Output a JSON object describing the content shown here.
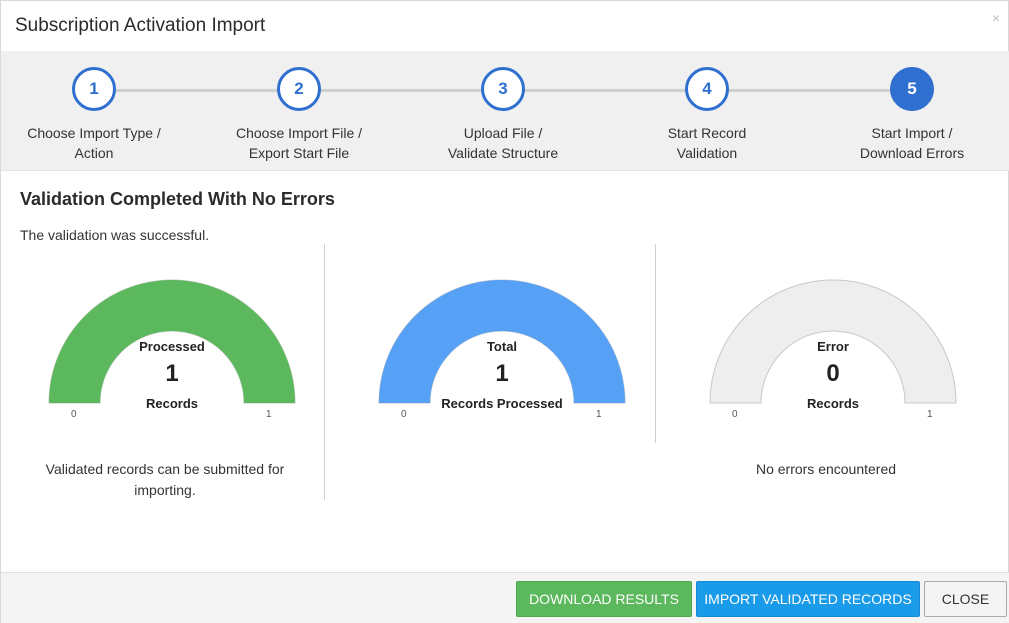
{
  "dialog": {
    "title": "Subscription Activation Import",
    "close_glyph": "×"
  },
  "steps": [
    {
      "number": "1",
      "line1": "Choose Import Type /",
      "line2": "Action"
    },
    {
      "number": "2",
      "line1": "Choose Import File /",
      "line2": "Export Start File"
    },
    {
      "number": "3",
      "line1": "Upload File /",
      "line2": "Validate Structure"
    },
    {
      "number": "4",
      "line1": "Start Record",
      "line2": "Validation"
    },
    {
      "number": "5",
      "line1": "Start Import /",
      "line2": "Download Errors"
    }
  ],
  "active_step": 5,
  "content": {
    "heading": "Validation Completed With No Errors",
    "subtext": "The validation was successful."
  },
  "gauges": [
    {
      "title": "Processed",
      "value": "1",
      "caption": "Records",
      "min": "0",
      "max": "1",
      "fraction": 1,
      "color": "#5cb85c",
      "description_line1": "Validated records can be submitted for",
      "description_line2": "importing."
    },
    {
      "title": "Total",
      "value": "1",
      "caption": "Records Processed",
      "min": "0",
      "max": "1",
      "fraction": 1,
      "color": "#56a0f5",
      "description_line1": "",
      "description_line2": ""
    },
    {
      "title": "Error",
      "value": "0",
      "caption": "Records",
      "min": "0",
      "max": "1",
      "fraction": 0,
      "color": "#eeeeee",
      "description_line1": "No errors encountered",
      "description_line2": ""
    }
  ],
  "footer": {
    "download_label": "DOWNLOAD RESULTS",
    "import_label": "IMPORT VALIDATED RECORDS",
    "close_label": "CLOSE"
  }
}
